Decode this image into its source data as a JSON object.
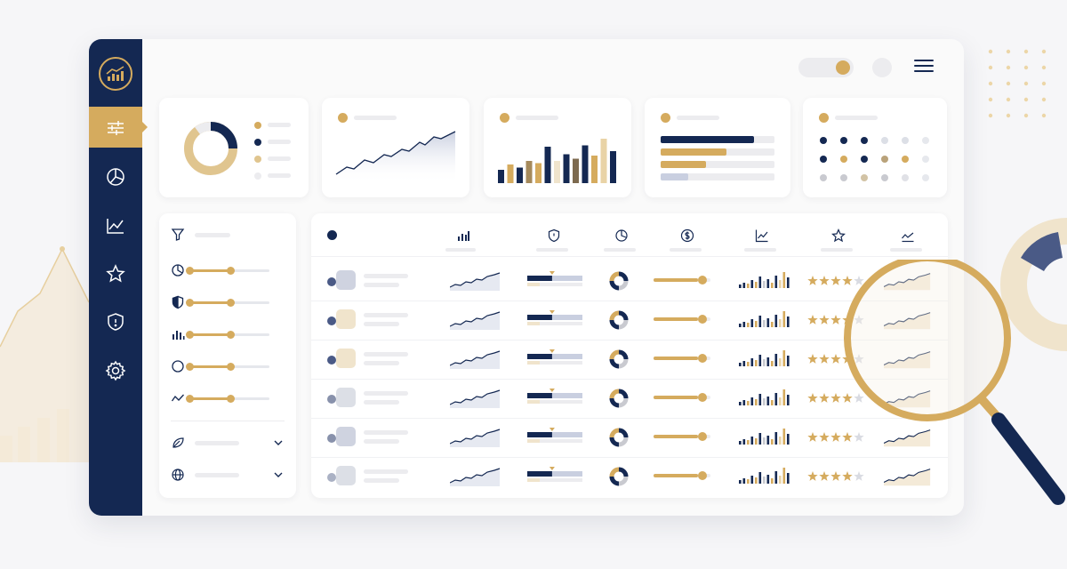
{
  "page": {
    "title": ""
  },
  "colors": {
    "navy": "#142852",
    "gold": "#d5ab5e",
    "beige": "#f0e4cc",
    "gray": "#ececef",
    "slate": "#4a5a86"
  },
  "sidebar": {
    "logo_icon": "growth-chart-logo-icon",
    "items": [
      {
        "name": "filters",
        "icon": "sliders-icon",
        "active": true
      },
      {
        "name": "analytics",
        "icon": "pie-chart-icon"
      },
      {
        "name": "trends",
        "icon": "line-chart-icon"
      },
      {
        "name": "favorites",
        "icon": "star-icon"
      },
      {
        "name": "security",
        "icon": "shield-icon"
      },
      {
        "name": "settings",
        "icon": "gear-icon"
      }
    ]
  },
  "header": {
    "toggle_on": true,
    "menu_icon": "hamburger-icon"
  },
  "widgets": [
    {
      "type": "donut",
      "legend_colors": [
        "#d5ab5e",
        "#142852",
        "#e0c58f",
        "#ececef"
      ]
    },
    {
      "type": "area-line"
    },
    {
      "type": "bar"
    },
    {
      "type": "horizontal-bars",
      "fractions": [
        0.82,
        0.58,
        0.4,
        0.24
      ]
    },
    {
      "type": "dot-matrix",
      "rows": 3,
      "cols": 6
    }
  ],
  "filters": {
    "icons": [
      "filter-icon",
      "pie-chart-icon",
      "shield-icon",
      "bar-chart-icon",
      "circle-icon",
      "trend-icon"
    ],
    "dropdowns": [
      {
        "icon": "leaf-icon"
      },
      {
        "icon": "globe-icon"
      }
    ]
  },
  "table": {
    "columns": [
      "bar-chart-icon",
      "shield-icon",
      "pie-chart-icon",
      "dollar-icon",
      "line-chart-icon",
      "star-icon",
      "trend-icon"
    ],
    "rows": [
      {
        "rating": 4,
        "progress": 0.45,
        "slider": 0.78
      },
      {
        "rating": 4,
        "progress": 0.45,
        "slider": 0.78
      },
      {
        "rating": 4,
        "progress": 0.45,
        "slider": 0.78
      },
      {
        "rating": 4,
        "progress": 0.45,
        "slider": 0.78
      },
      {
        "rating": 4,
        "progress": 0.45,
        "slider": 0.78
      },
      {
        "rating": 4,
        "progress": 0.45,
        "slider": 0.78
      }
    ]
  }
}
